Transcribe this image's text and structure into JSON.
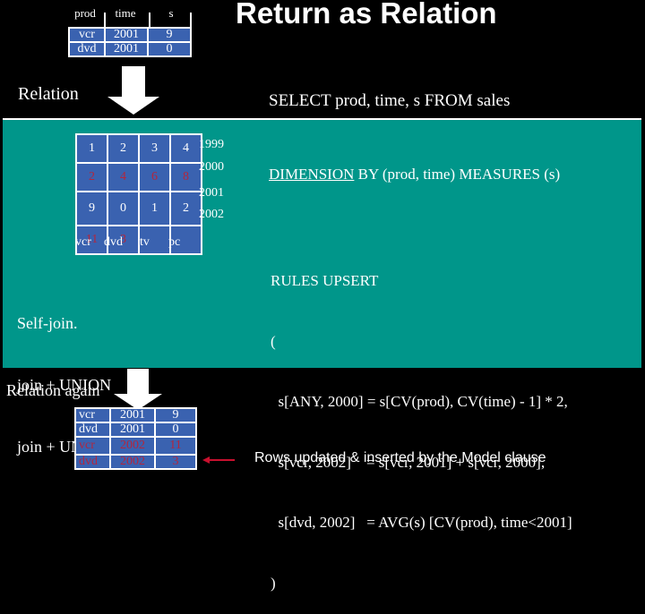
{
  "title": "Return as Relation",
  "input_relation": {
    "columns": [
      "prod",
      "time",
      "s"
    ],
    "rows": [
      [
        "vcr",
        "2001",
        "9"
      ],
      [
        "dvd",
        "2001",
        "0"
      ]
    ]
  },
  "label_relation": "Relation",
  "select_statement": "SELECT prod, time, s FROM sales",
  "cube": {
    "rows": [
      {
        "year": "1999",
        "values": [
          "1",
          "2",
          "3",
          "4"
        ],
        "highlight": false
      },
      {
        "year": "2000",
        "values": [
          "2",
          "4",
          "6",
          "8"
        ],
        "highlight": true
      },
      {
        "year": "2001",
        "values": [
          "9",
          "0",
          "1",
          "2"
        ],
        "highlight": false
      },
      {
        "year": "2002",
        "values": [
          "11",
          "3",
          "",
          ""
        ],
        "highlight": true
      }
    ],
    "columns": [
      "vcr",
      "dvd",
      "tv",
      "pc"
    ]
  },
  "dimension_clause": {
    "keyword": "DIMENSION",
    "rest": " BY (prod, time) MEASURES (s)"
  },
  "rules": [
    "RULES UPSERT",
    "(",
    "  s[ANY, 2000] = s[CV(prod), CV(time) - 1] * 2,",
    "  s[vcr, 2002]    = s[vcr, 2001] + s[vcr, 2000],",
    "  s[dvd, 2002]   = AVG(s) [CV(prod), time<2001]",
    ")"
  ],
  "sql_equivalent": [
    "Self-join.",
    "join + UNION",
    "join + UNION"
  ],
  "label_relation_again": "Relation again",
  "output_relation": {
    "rows": [
      {
        "cells": [
          "vcr",
          "2001",
          "9"
        ],
        "highlight": false
      },
      {
        "cells": [
          "dvd",
          "2001",
          "0"
        ],
        "highlight": false
      },
      {
        "cells": [
          "vcr",
          "2002",
          "11"
        ],
        "highlight": true
      },
      {
        "cells": [
          "dvd",
          "2002",
          "3"
        ],
        "highlight": true
      }
    ]
  },
  "note": "Rows updated & inserted by the Model clause",
  "colors": {
    "background": "#000000",
    "panel": "#00968a",
    "cell": "#3a62b0",
    "highlight_text": "#b3263d",
    "arrow_note": "#c8102e"
  }
}
